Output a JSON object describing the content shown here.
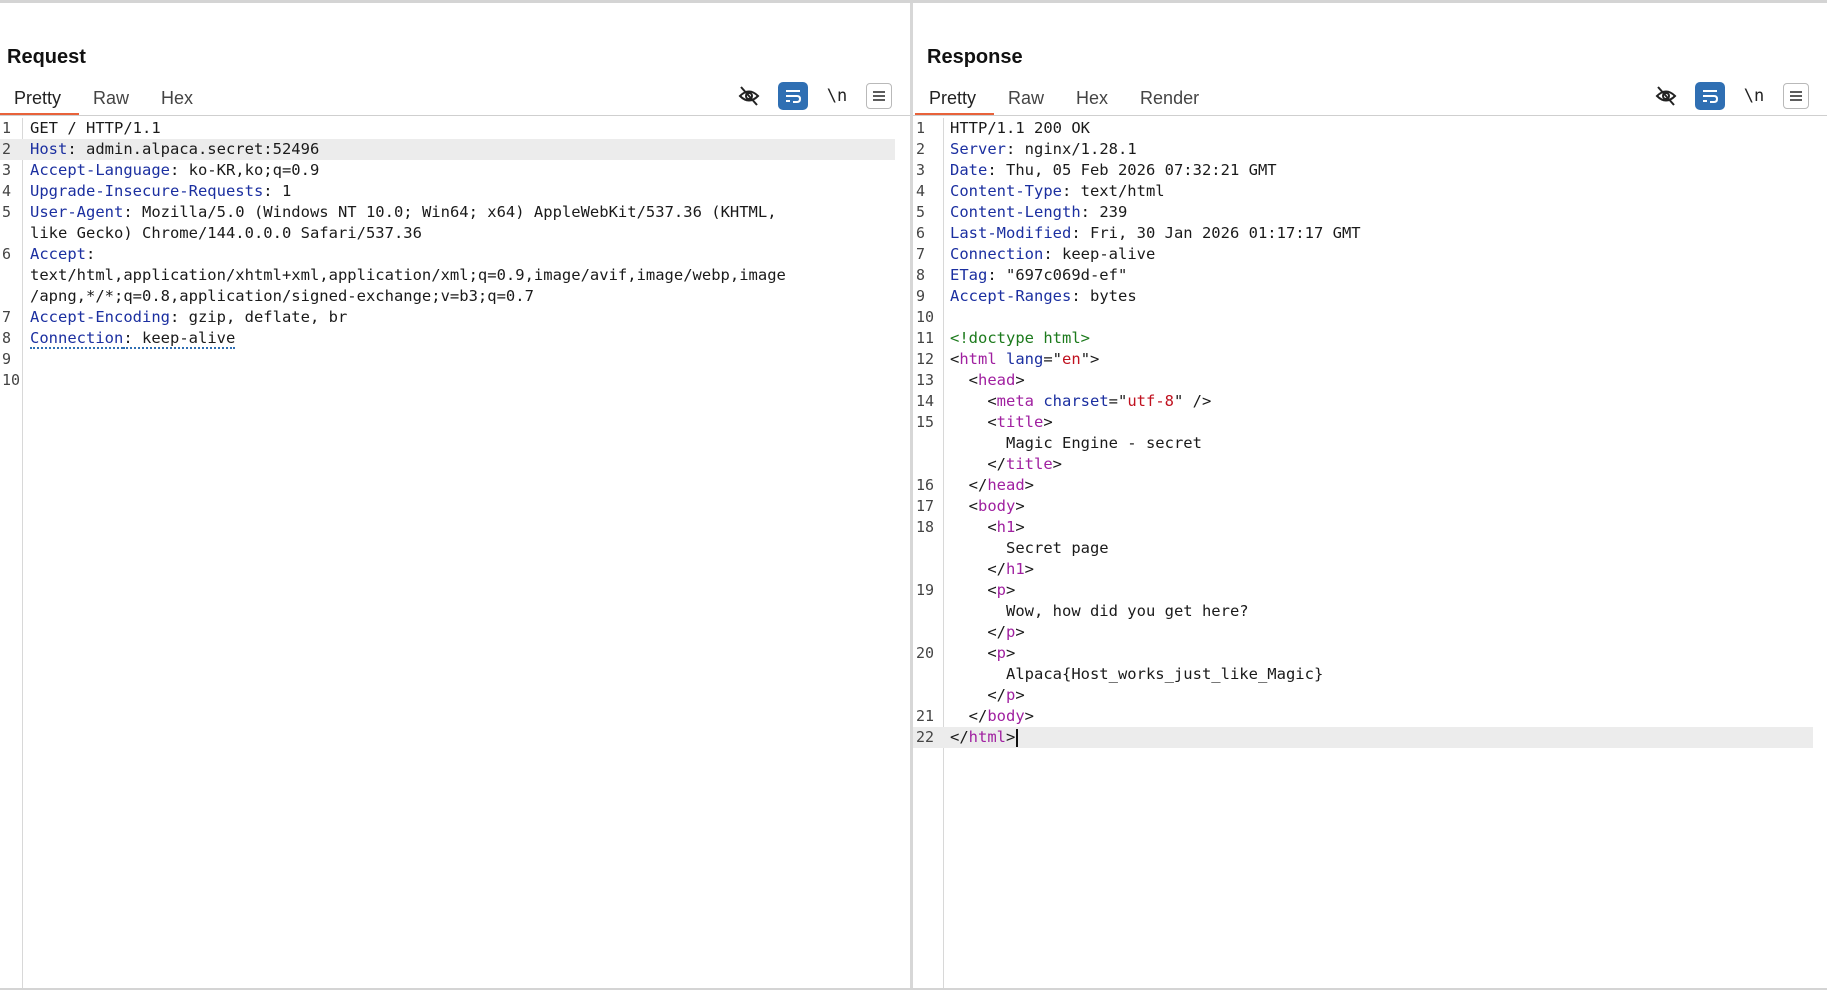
{
  "layout_switch": {
    "options": [
      "split-horizontal-icon",
      "split-vertical-icon",
      "single-panel-icon"
    ],
    "active": 0
  },
  "request": {
    "title": "Request",
    "tabs": [
      "Pretty",
      "Raw",
      "Hex"
    ],
    "active_tab": 0,
    "toolbar": {
      "newline_label": "\\n"
    },
    "lines": [
      {
        "num": "1",
        "parts": [
          {
            "t": "GET / HTTP/1.1",
            "c": "plain"
          }
        ]
      },
      {
        "num": "2",
        "hl": true,
        "parts": [
          {
            "t": "Host",
            "c": "hk"
          },
          {
            "t": ": admin.alpaca.secret:52496",
            "c": "hv"
          }
        ]
      },
      {
        "num": "3",
        "parts": [
          {
            "t": "Accept-Language",
            "c": "hk"
          },
          {
            "t": ": ko-KR,ko;q=0.9",
            "c": "hv"
          }
        ]
      },
      {
        "num": "4",
        "parts": [
          {
            "t": "Upgrade-Insecure-Requests",
            "c": "hk"
          },
          {
            "t": ": 1",
            "c": "hv"
          }
        ]
      },
      {
        "num": "5",
        "parts": [
          {
            "t": "User-Agent",
            "c": "hk"
          },
          {
            "t": ": Mozilla/5.0 (Windows NT 10.0; Win64; x64) AppleWebKit/537.36 (KHTML,",
            "c": "hv"
          }
        ]
      },
      {
        "num": "",
        "parts": [
          {
            "t": "like Gecko) Chrome/144.0.0.0 Safari/537.36",
            "c": "hv"
          }
        ]
      },
      {
        "num": "6",
        "parts": [
          {
            "t": "Accept",
            "c": "hk"
          },
          {
            "t": ":",
            "c": "hv"
          }
        ]
      },
      {
        "num": "",
        "parts": [
          {
            "t": "text/html,application/xhtml+xml,application/xml;q=0.9,image/avif,image/webp,image",
            "c": "hv"
          }
        ]
      },
      {
        "num": "",
        "parts": [
          {
            "t": "/apng,*/*;q=0.8,application/signed-exchange;v=b3;q=0.7",
            "c": "hv"
          }
        ]
      },
      {
        "num": "7",
        "parts": [
          {
            "t": "Accept-Encoding",
            "c": "hk"
          },
          {
            "t": ": gzip, deflate, br",
            "c": "hv"
          }
        ]
      },
      {
        "num": "8",
        "parts": [
          {
            "t": "Connection",
            "c": "hk dotted"
          },
          {
            "t": ": keep-alive",
            "c": "hv dotted"
          }
        ]
      },
      {
        "num": "9",
        "parts": []
      },
      {
        "num": "10",
        "parts": []
      }
    ]
  },
  "response": {
    "title": "Response",
    "tabs": [
      "Pretty",
      "Raw",
      "Hex",
      "Render"
    ],
    "active_tab": 0,
    "toolbar": {
      "newline_label": "\\n"
    },
    "lines": [
      {
        "num": "1",
        "parts": [
          {
            "t": "HTTP/1.1 200 OK",
            "c": "plain"
          }
        ]
      },
      {
        "num": "2",
        "parts": [
          {
            "t": "Server",
            "c": "hk"
          },
          {
            "t": ": nginx/1.28.1",
            "c": "hv"
          }
        ]
      },
      {
        "num": "3",
        "parts": [
          {
            "t": "Date",
            "c": "hk"
          },
          {
            "t": ": Thu, 05 Feb 2026 07:32:21 GMT",
            "c": "hv"
          }
        ]
      },
      {
        "num": "4",
        "parts": [
          {
            "t": "Content-Type",
            "c": "hk"
          },
          {
            "t": ": text/html",
            "c": "hv"
          }
        ]
      },
      {
        "num": "5",
        "parts": [
          {
            "t": "Content-Length",
            "c": "hk"
          },
          {
            "t": ": 239",
            "c": "hv"
          }
        ]
      },
      {
        "num": "6",
        "parts": [
          {
            "t": "Last-Modified",
            "c": "hk"
          },
          {
            "t": ": Fri, 30 Jan 2026 01:17:17 GMT",
            "c": "hv"
          }
        ]
      },
      {
        "num": "7",
        "parts": [
          {
            "t": "Connection",
            "c": "hk"
          },
          {
            "t": ": keep-alive",
            "c": "hv"
          }
        ]
      },
      {
        "num": "8",
        "parts": [
          {
            "t": "ETag",
            "c": "hk"
          },
          {
            "t": ": \"697c069d-ef\"",
            "c": "hv"
          }
        ]
      },
      {
        "num": "9",
        "parts": [
          {
            "t": "Accept-Ranges",
            "c": "hk"
          },
          {
            "t": ": bytes",
            "c": "hv"
          }
        ]
      },
      {
        "num": "10",
        "parts": []
      },
      {
        "num": "11",
        "parts": [
          {
            "t": "<!doctype html>",
            "c": "doctype"
          }
        ]
      },
      {
        "num": "12",
        "parts": [
          {
            "t": "<",
            "c": "plain"
          },
          {
            "t": "html",
            "c": "tag"
          },
          {
            "t": " ",
            "c": "plain"
          },
          {
            "t": "lang",
            "c": "attr"
          },
          {
            "t": "=\"",
            "c": "plain"
          },
          {
            "t": "en",
            "c": "attrv"
          },
          {
            "t": "\">",
            "c": "plain"
          }
        ]
      },
      {
        "num": "13",
        "parts": [
          {
            "t": "  <",
            "c": "plain"
          },
          {
            "t": "head",
            "c": "tag"
          },
          {
            "t": ">",
            "c": "plain"
          }
        ]
      },
      {
        "num": "14",
        "parts": [
          {
            "t": "    <",
            "c": "plain"
          },
          {
            "t": "meta",
            "c": "tag"
          },
          {
            "t": " ",
            "c": "plain"
          },
          {
            "t": "charset",
            "c": "attr"
          },
          {
            "t": "=\"",
            "c": "plain"
          },
          {
            "t": "utf-8",
            "c": "attrv"
          },
          {
            "t": "\" />",
            "c": "plain"
          }
        ]
      },
      {
        "num": "15",
        "parts": [
          {
            "t": "    <",
            "c": "plain"
          },
          {
            "t": "title",
            "c": "tag"
          },
          {
            "t": ">",
            "c": "plain"
          }
        ]
      },
      {
        "num": "",
        "parts": [
          {
            "t": "      Magic Engine - secret",
            "c": "plain"
          }
        ]
      },
      {
        "num": "",
        "parts": [
          {
            "t": "    </",
            "c": "plain"
          },
          {
            "t": "title",
            "c": "tag"
          },
          {
            "t": ">",
            "c": "plain"
          }
        ]
      },
      {
        "num": "16",
        "parts": [
          {
            "t": "  </",
            "c": "plain"
          },
          {
            "t": "head",
            "c": "tag"
          },
          {
            "t": ">",
            "c": "plain"
          }
        ]
      },
      {
        "num": "17",
        "parts": [
          {
            "t": "  <",
            "c": "plain"
          },
          {
            "t": "body",
            "c": "tag"
          },
          {
            "t": ">",
            "c": "plain"
          }
        ]
      },
      {
        "num": "18",
        "parts": [
          {
            "t": "    <",
            "c": "plain"
          },
          {
            "t": "h1",
            "c": "tag"
          },
          {
            "t": ">",
            "c": "plain"
          }
        ]
      },
      {
        "num": "",
        "parts": [
          {
            "t": "      Secret page",
            "c": "plain"
          }
        ]
      },
      {
        "num": "",
        "parts": [
          {
            "t": "    </",
            "c": "plain"
          },
          {
            "t": "h1",
            "c": "tag"
          },
          {
            "t": ">",
            "c": "plain"
          }
        ]
      },
      {
        "num": "19",
        "parts": [
          {
            "t": "    <",
            "c": "plain"
          },
          {
            "t": "p",
            "c": "tag"
          },
          {
            "t": ">",
            "c": "plain"
          }
        ]
      },
      {
        "num": "",
        "parts": [
          {
            "t": "      Wow, how did you get here?",
            "c": "plain"
          }
        ]
      },
      {
        "num": "",
        "parts": [
          {
            "t": "    </",
            "c": "plain"
          },
          {
            "t": "p",
            "c": "tag"
          },
          {
            "t": ">",
            "c": "plain"
          }
        ]
      },
      {
        "num": "20",
        "parts": [
          {
            "t": "    <",
            "c": "plain"
          },
          {
            "t": "p",
            "c": "tag"
          },
          {
            "t": ">",
            "c": "plain"
          }
        ]
      },
      {
        "num": "",
        "parts": [
          {
            "t": "      Alpaca{Host_works_just_like_Magic}",
            "c": "plain"
          }
        ]
      },
      {
        "num": "",
        "parts": [
          {
            "t": "    </",
            "c": "plain"
          },
          {
            "t": "p",
            "c": "tag"
          },
          {
            "t": ">",
            "c": "plain"
          }
        ]
      },
      {
        "num": "21",
        "parts": [
          {
            "t": "  </",
            "c": "plain"
          },
          {
            "t": "body",
            "c": "tag"
          },
          {
            "t": ">",
            "c": "plain"
          }
        ]
      },
      {
        "num": "22",
        "hl": true,
        "caret": true,
        "parts": [
          {
            "t": "</",
            "c": "plain"
          },
          {
            "t": "html",
            "c": "tag"
          },
          {
            "t": ">",
            "c": "plain"
          }
        ]
      }
    ]
  }
}
